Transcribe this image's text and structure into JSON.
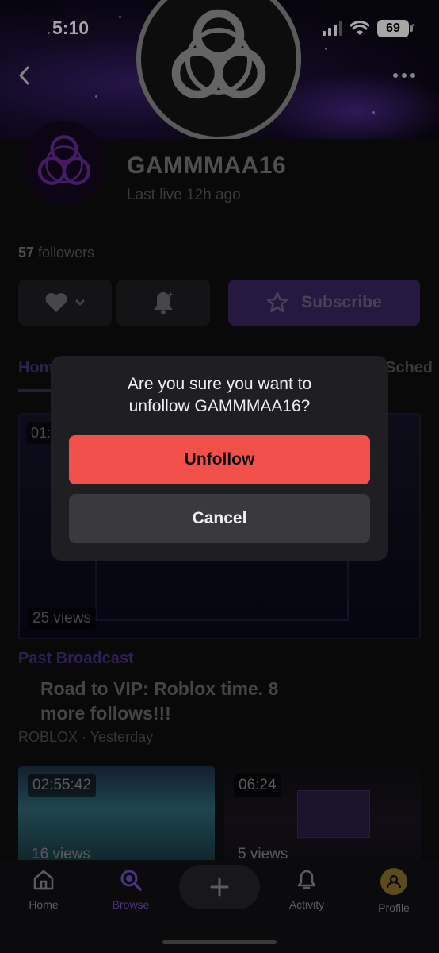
{
  "status_bar": {
    "time": "5:10",
    "battery": "69"
  },
  "channel": {
    "name": "GAMMMAA16",
    "last_live": "Last live 12h ago",
    "followers_count": "57",
    "followers_label": "followers"
  },
  "actions": {
    "subscribe_label": "Subscribe"
  },
  "tabs": {
    "home": "Hom",
    "schedule": "Sched"
  },
  "featured_video": {
    "duration": "01:",
    "views": "25 views",
    "type_label": "Past Broadcast",
    "title": "Road to VIP: Roblox time. 8 more follows!!!",
    "meta": "ROBLOX · Yesterday"
  },
  "more_videos": [
    {
      "duration": "02:55:42",
      "views": "16 views"
    },
    {
      "duration": "06:24",
      "views": "5 views"
    }
  ],
  "dialog": {
    "message": "Are you sure you want to unfollow GAMMMAA16?",
    "confirm_label": "Unfollow",
    "cancel_label": "Cancel"
  },
  "bottom_nav": {
    "home": "Home",
    "browse": "Browse",
    "activity": "Activity",
    "profile": "Profile"
  },
  "colors": {
    "accent": "#9147ff",
    "unfollow": "#f2504b",
    "dialog_bg": "#1f1f23"
  }
}
